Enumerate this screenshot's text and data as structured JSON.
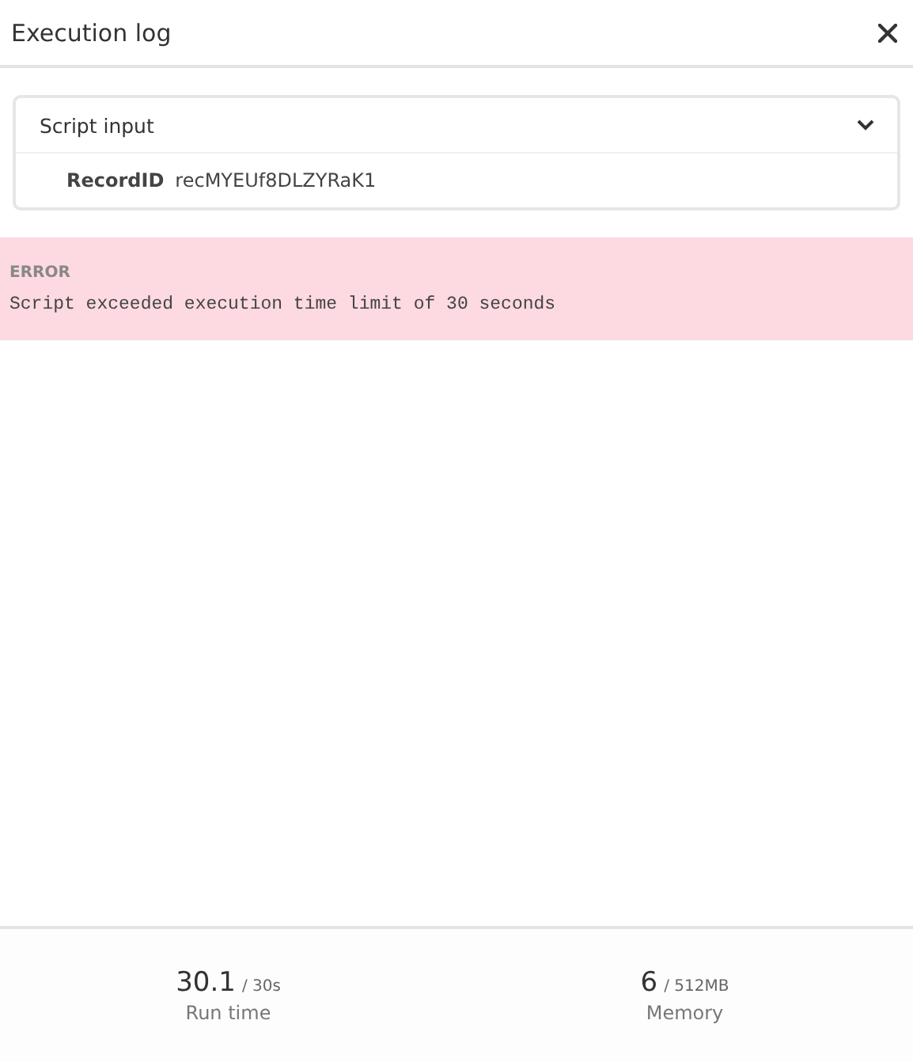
{
  "window": {
    "title": "Execution log"
  },
  "script_input": {
    "title": "Script input",
    "expanded": true,
    "fields": [
      {
        "label": "RecordID",
        "value": "recMYEUf8DLZYRaK1"
      }
    ]
  },
  "error": {
    "label": "ERROR",
    "message": "Script exceeded execution time limit of 30 seconds"
  },
  "stats": [
    {
      "value": "30.1",
      "limit": "/ 30s",
      "label": "Run time"
    },
    {
      "value": "6",
      "limit": "/ 512MB",
      "label": "Memory"
    }
  ]
}
